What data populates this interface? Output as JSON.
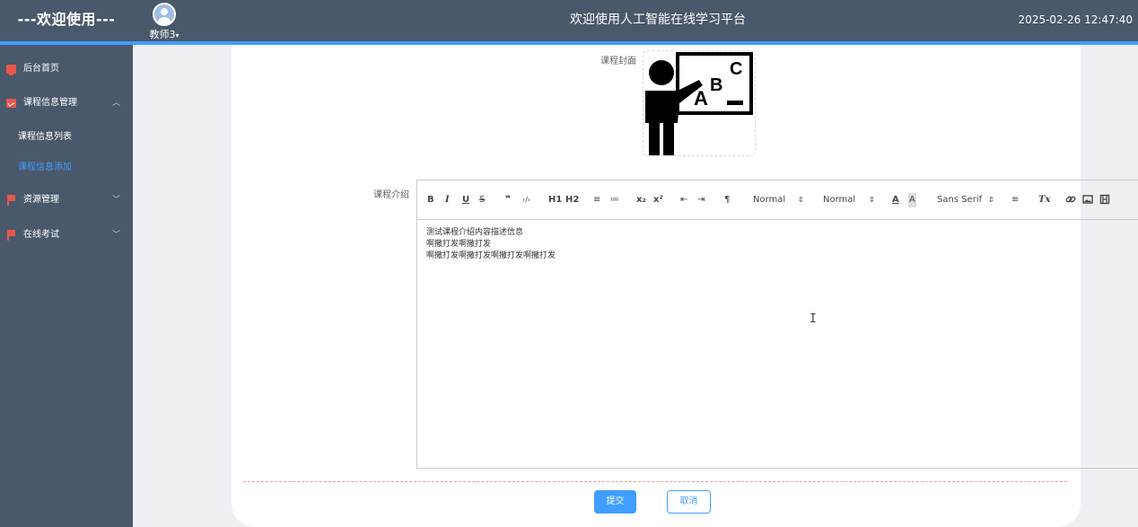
{
  "header": {
    "brand": "---欢迎使用---",
    "user_name": "教师3",
    "user_caret": "▾",
    "platform_title": "欢迎使用人工智能在线学习平台",
    "datetime": "2025-02-26 12:47:40"
  },
  "sidebar": {
    "items": [
      {
        "label": "后台首页",
        "icon": "monitor-icon"
      },
      {
        "label": "课程信息管理",
        "icon": "chart-icon",
        "arrow": "︿"
      },
      {
        "label": "资源管理",
        "icon": "flag-icon",
        "arrow": "﹀"
      },
      {
        "label": "在线考试",
        "icon": "flag-icon",
        "arrow": "﹀"
      }
    ],
    "subitems": [
      {
        "label": "课程信息列表"
      },
      {
        "label": "课程信息添加"
      }
    ]
  },
  "form": {
    "cover_label": "课程封面",
    "cover_image": "teacher-blackboard-abc",
    "cover_letters": [
      "A",
      "B",
      "C"
    ],
    "intro_label": "课程介绍",
    "toolbar": {
      "buttons": [
        "B",
        "I",
        "U",
        "S",
        "❞",
        "‹/›",
        "H1",
        "H2",
        "≡",
        "≔",
        "x₂",
        "x²",
        "⇤",
        "⇥",
        "¶"
      ],
      "size_select": "Normal",
      "header_select": "Normal",
      "font_color": "A",
      "font_bg": "A",
      "font_select": "Sans Serif",
      "align": "≡",
      "clean": "Tx",
      "select_arrow": "⇕"
    },
    "editor_lines": [
      "测试课程介绍内容描述信息",
      "啊撒打发啊撒打发",
      "啊撒打发啊撒打发啊撒打发啊撒打发"
    ],
    "cursor": "I",
    "submit_label": "提交",
    "cancel_label": "取消"
  }
}
